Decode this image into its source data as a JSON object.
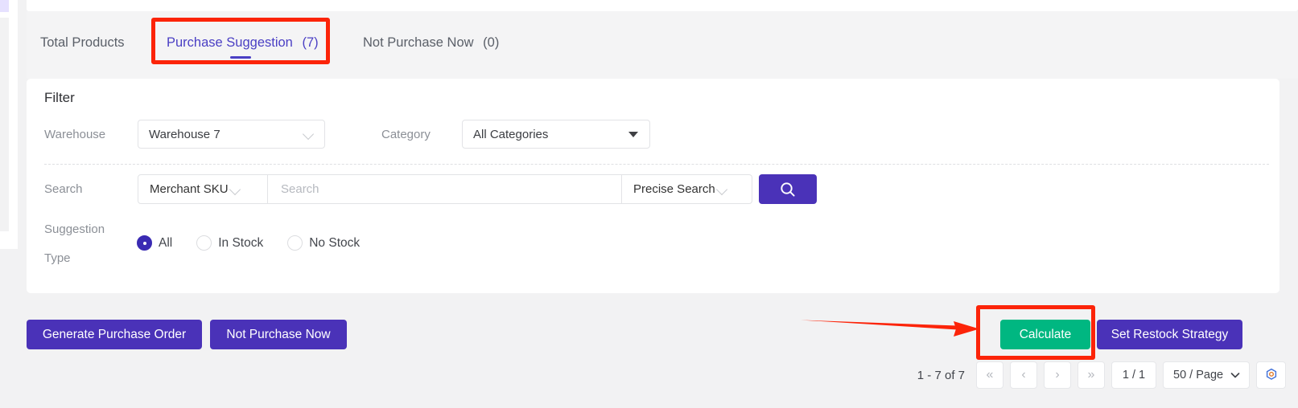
{
  "tabs": [
    {
      "label": "Total Products",
      "count": "",
      "active": false
    },
    {
      "label": "Purchase Suggestion",
      "count": "(7)",
      "active": true
    },
    {
      "label": "Not Purchase Now",
      "count": "(0)",
      "active": false
    }
  ],
  "filter": {
    "title": "Filter",
    "warehouse_label": "Warehouse",
    "warehouse_value": "Warehouse 7",
    "category_label": "Category",
    "category_value": "All Categories",
    "search_label": "Search",
    "search_field_value": "Merchant SKU",
    "search_input_value": "",
    "search_input_placeholder": "Search",
    "search_mode_value": "Precise Search",
    "search_button_icon": "search-icon",
    "suggestion_label_line1": "Suggestion",
    "suggestion_label_line2": "Type",
    "suggestion_options": [
      {
        "label": "All",
        "selected": true
      },
      {
        "label": "In Stock",
        "selected": false
      },
      {
        "label": "No Stock",
        "selected": false
      }
    ]
  },
  "actions": {
    "generate_purchase_order": "Generate Purchase Order",
    "not_purchase_now": "Not Purchase Now",
    "calculate": "Calculate",
    "set_restock_strategy": "Set Restock Strategy"
  },
  "pagination": {
    "total_text": "1 - 7 of 7",
    "first_icon": "«",
    "prev_icon": "‹",
    "next_icon": "›",
    "last_icon": "»",
    "current_page": "1 / 1",
    "page_size": "50 / Page",
    "settings_icon": "gear-icon"
  },
  "colors": {
    "primary_purple": "#4a32b8",
    "tab_active": "#4a3fc4",
    "green": "#00b781",
    "annotation_red": "#fc2409",
    "page_bg": "#f2f2f3"
  }
}
